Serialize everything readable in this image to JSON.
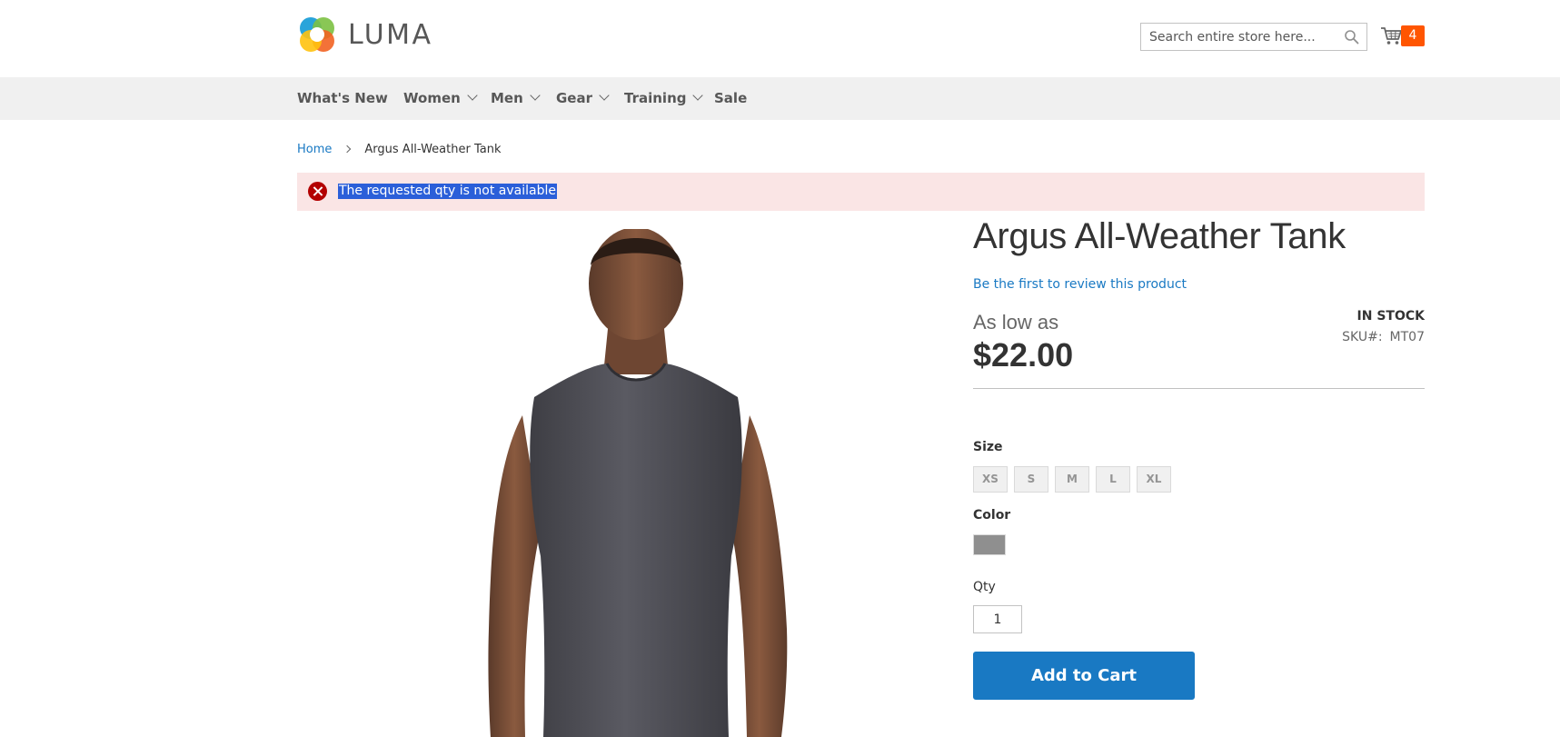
{
  "header": {
    "logo_text": "LUMA",
    "search": {
      "placeholder": "Search entire store here...",
      "value": ""
    },
    "cart_count": "4"
  },
  "nav": {
    "items": [
      {
        "label": "What's New",
        "has_dropdown": false
      },
      {
        "label": "Women",
        "has_dropdown": true
      },
      {
        "label": "Men",
        "has_dropdown": true
      },
      {
        "label": "Gear",
        "has_dropdown": true
      },
      {
        "label": "Training",
        "has_dropdown": true
      },
      {
        "label": "Sale",
        "has_dropdown": false
      }
    ]
  },
  "breadcrumb": {
    "home": "Home",
    "current": "Argus All-Weather Tank"
  },
  "message": {
    "type": "error",
    "text": "The requested qty is not available"
  },
  "product": {
    "title": "Argus All-Weather Tank",
    "review_link": "Be the first to review this product",
    "price_prefix": "As low as",
    "price": "$22.00",
    "stock": "IN STOCK",
    "sku_label": "SKU#:",
    "sku_value": "MT07",
    "size_label": "Size",
    "sizes": [
      "XS",
      "S",
      "M",
      "L",
      "XL"
    ],
    "color_label": "Color",
    "color_swatch": "#8f8f8f",
    "qty_label": "Qty",
    "qty_value": "1",
    "add_to_cart": "Add to Cart"
  },
  "colors": {
    "accent": "#1979c3",
    "cart_badge": "#ff5501",
    "error_bg": "#fae5e5",
    "error_icon": "#b30000",
    "nav_bg": "#f0f0f0"
  }
}
